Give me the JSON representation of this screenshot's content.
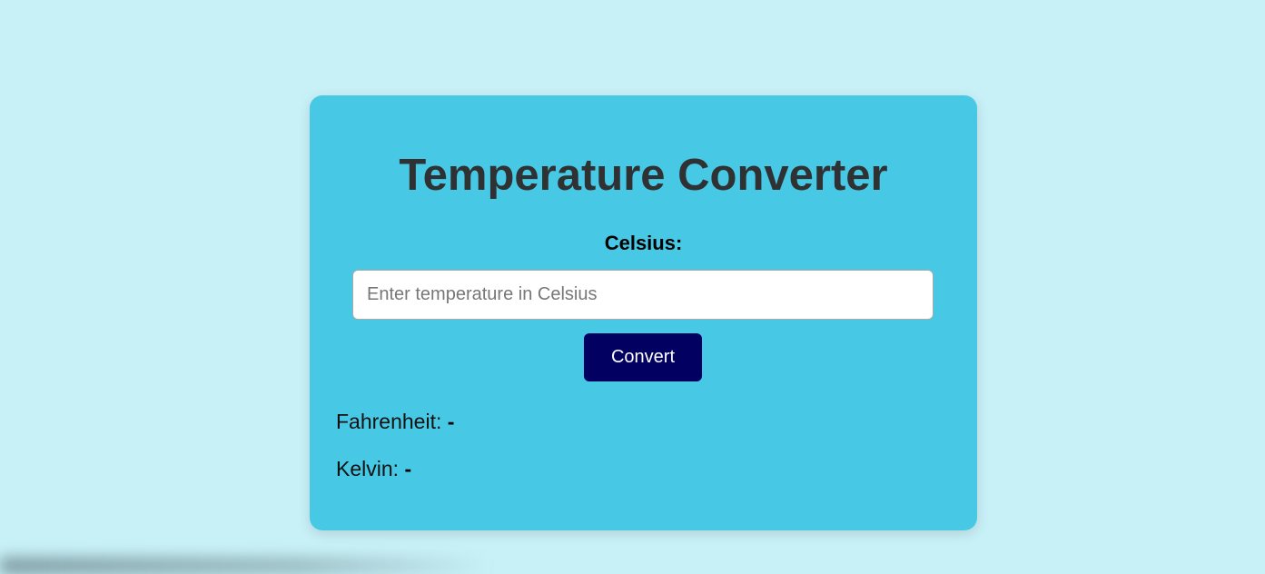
{
  "app": {
    "title": "Temperature Converter"
  },
  "form": {
    "label": "Celsius:",
    "input_value": "",
    "input_placeholder": "Enter temperature in Celsius",
    "button_label": "Convert"
  },
  "results": {
    "fahrenheit_label": "Fahrenheit:",
    "fahrenheit_value": "-",
    "kelvin_label": "Kelvin:",
    "kelvin_value": "-"
  },
  "colors": {
    "page_background": "#c8f0f7",
    "card_background": "#47c9e5",
    "button_background": "#020060",
    "title_color": "#2f3133"
  }
}
